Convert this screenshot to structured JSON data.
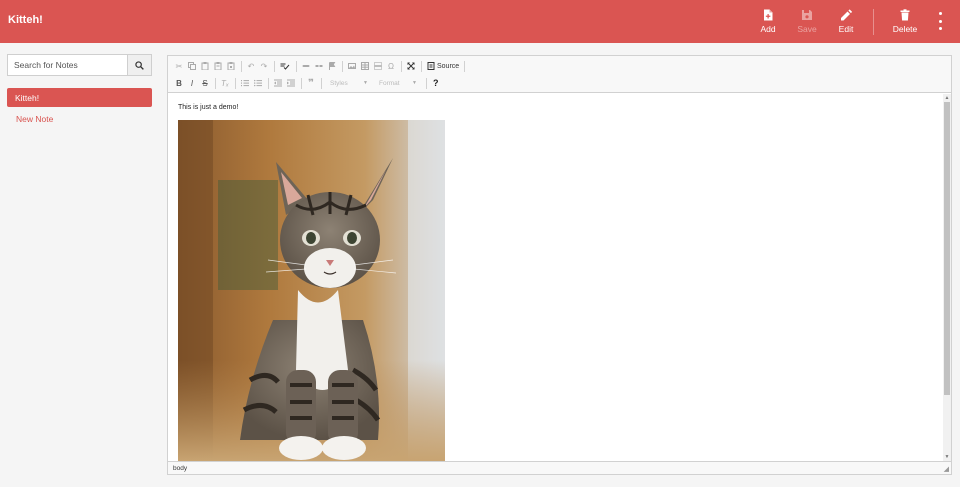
{
  "header": {
    "title": "Kitteh!",
    "buttons": {
      "add": "Add",
      "save": "Save",
      "edit": "Edit",
      "delete": "Delete"
    },
    "accent": "#da5552"
  },
  "sidebar": {
    "search_placeholder": "Search for Notes",
    "notes": [
      {
        "title": "Kitteh!",
        "active": true
      },
      {
        "title": "New Note",
        "active": false
      }
    ]
  },
  "editor": {
    "toolbar": {
      "source_label": "Source",
      "styles_label": "Styles",
      "format_label": "Format",
      "help_label": "?"
    },
    "content_text": "This is just a demo!",
    "statusbar_path": "body"
  }
}
